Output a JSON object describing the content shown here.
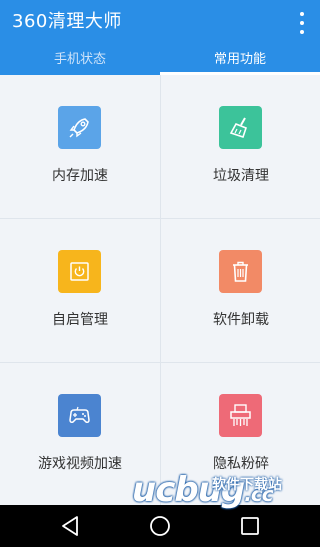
{
  "app": {
    "title": "360清理大师"
  },
  "tabs": [
    {
      "label": "手机状态",
      "active": false
    },
    {
      "label": "常用功能",
      "active": true
    }
  ],
  "features": [
    {
      "label": "内存加速",
      "icon": "rocket-icon",
      "color": "#5ba4e8"
    },
    {
      "label": "垃圾清理",
      "icon": "broom-icon",
      "color": "#3cc39a"
    },
    {
      "label": "自启管理",
      "icon": "power-icon",
      "color": "#f7b51c"
    },
    {
      "label": "软件卸载",
      "icon": "trash-icon",
      "color": "#f28a66"
    },
    {
      "label": "游戏视频加速",
      "icon": "gamepad-icon",
      "color": "#4b84d0"
    },
    {
      "label": "隐私粉碎",
      "icon": "shredder-icon",
      "color": "#ee6a77"
    }
  ],
  "colors": {
    "appbar": "#2a8ee6",
    "background": "#f1f4f8"
  },
  "watermark": {
    "main": "ucbug",
    "sub": "软件下载站",
    "suffix": ".cc"
  },
  "navbar": {
    "buttons": [
      "back-icon",
      "home-icon",
      "recents-icon"
    ]
  }
}
